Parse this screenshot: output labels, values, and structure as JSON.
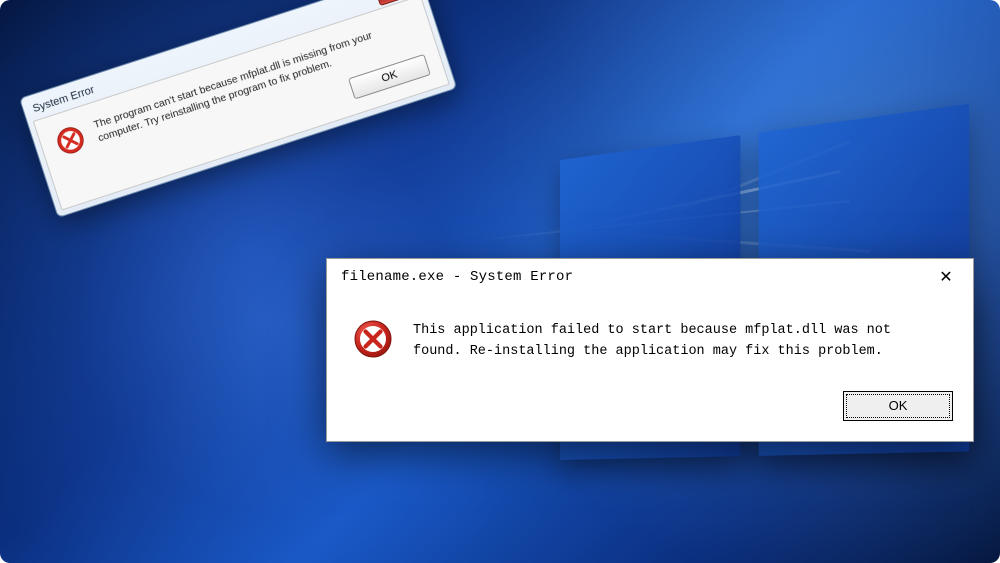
{
  "dialogMain": {
    "title": "filename.exe - System Error",
    "message": "This application failed to start because mfplat.dll was not found. Re-installing the application may fix this problem.",
    "okLabel": "OK",
    "closeGlyph": "✕"
  },
  "dialogBack": {
    "title": "System Error",
    "message": "The program can't start because mfplat.dll is missing from your computer. Try reinstalling the program to fix problem.",
    "okLabel": "OK",
    "closeGlyph": "✕"
  },
  "icons": {
    "error": "error-icon"
  }
}
